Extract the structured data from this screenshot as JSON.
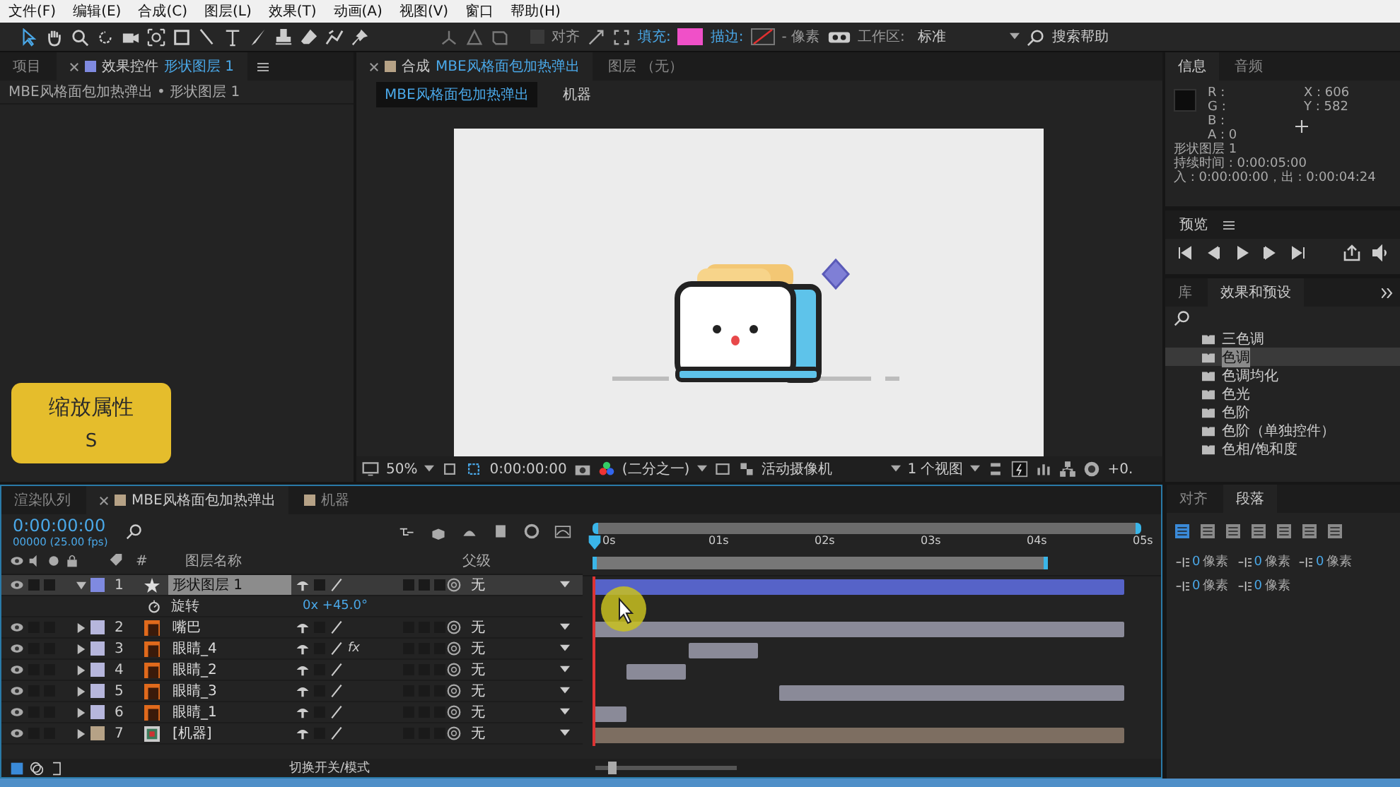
{
  "menu": [
    "文件(F)",
    "编辑(E)",
    "合成(C)",
    "图层(L)",
    "效果(T)",
    "动画(A)",
    "视图(V)",
    "窗口",
    "帮助(H)"
  ],
  "toolbar": {
    "snap": {
      "label": "对齐",
      "checked": false
    },
    "fill": {
      "label": "填充:",
      "color": "#f050c8"
    },
    "stroke": {
      "label": "描边:"
    },
    "stroke_width": "- 像素",
    "workspace_label": "工作区:",
    "workspace": "标准",
    "search_help": "搜索帮助"
  },
  "left_panel": {
    "tabs": [
      {
        "label": "项目",
        "selected": false
      },
      {
        "label": "效果控件",
        "target": "形状图层 1",
        "selected": true
      }
    ],
    "breadcrumb": "MBE风格面包加热弹出 • 形状图层 1"
  },
  "callout": {
    "title": "缩放属性",
    "key": "S"
  },
  "comp_panel": {
    "tabs": [
      {
        "label": "合成",
        "target": "MBE风格面包加热弹出",
        "selected": true
      },
      {
        "label": "图层 （无）",
        "selected": false
      }
    ],
    "breadcrumb": [
      {
        "label": "MBE风格面包加热弹出",
        "selected": true
      },
      {
        "label": "机器",
        "selected": false
      }
    ],
    "footer": {
      "zoom": "50%",
      "time": "0:00:00:00",
      "resolution": "(二分之一)",
      "camera": "活动摄像机",
      "views": "1 个视图",
      "exposure": "+0."
    }
  },
  "info": {
    "tabs": [
      {
        "label": "信息",
        "selected": true
      },
      {
        "label": "音频",
        "selected": false
      }
    ],
    "channels": [
      "R :",
      "G :",
      "B :",
      "A : 0"
    ],
    "coords": [
      "X : 606",
      "Y : 582"
    ],
    "layer": "形状图层 1",
    "duration": "持续时间 : 0:00:05:00",
    "in_out": "入 : 0:00:00:00，出 : 0:00:04:24"
  },
  "preview": {
    "title": "预览"
  },
  "effects": {
    "tabs": [
      {
        "label": "库",
        "selected": false
      },
      {
        "label": "效果和预设",
        "selected": true
      }
    ],
    "items": [
      {
        "label": "三色调",
        "selected": false
      },
      {
        "label": "色调",
        "selected": true
      },
      {
        "label": "色调均化",
        "selected": false
      },
      {
        "label": "色光",
        "selected": false
      },
      {
        "label": "色阶",
        "selected": false
      },
      {
        "label": "色阶（单独控件）",
        "selected": false
      },
      {
        "label": "色相/饱和度",
        "selected": false
      }
    ]
  },
  "timeline": {
    "tabs": [
      {
        "label": "渲染队列",
        "selected": false
      },
      {
        "label": "MBE风格面包加热弹出",
        "selected": true
      },
      {
        "label": "机器",
        "selected": false
      }
    ],
    "time": "0:00:00:00",
    "fps": "00000 (25.00 fps)",
    "columns": {
      "number": "#",
      "name": "图层名称",
      "parent": "父级"
    },
    "layers": [
      {
        "number": "1",
        "name": "形状图层 1",
        "kind": "shape",
        "color": "#7f8ae0",
        "selected": true,
        "expanded": true,
        "parent": "无",
        "properties": [
          {
            "name": "旋转",
            "value": "0x +45.0°"
          }
        ]
      },
      {
        "number": "2",
        "name": "嘴巴",
        "kind": "ai",
        "color": "#b6b6dc",
        "selected": false,
        "expanded": false,
        "parent": "无"
      },
      {
        "number": "3",
        "name": "眼睛_4",
        "kind": "ai",
        "color": "#b6b6dc",
        "selected": false,
        "expanded": false,
        "badge": "fx",
        "parent": "无"
      },
      {
        "number": "4",
        "name": "眼睛_2",
        "kind": "ai",
        "color": "#b6b6dc",
        "selected": false,
        "expanded": false,
        "parent": "无"
      },
      {
        "number": "5",
        "name": "眼睛_3",
        "kind": "ai",
        "color": "#b6b6dc",
        "selected": false,
        "expanded": false,
        "parent": "无"
      },
      {
        "number": "6",
        "name": "眼睛_1",
        "kind": "ai",
        "color": "#b6b6dc",
        "selected": false,
        "expanded": false,
        "parent": "无"
      },
      {
        "number": "7",
        "name": "[机器]",
        "kind": "composition",
        "color": "#b6a286",
        "selected": false,
        "expanded": false,
        "parent": "无"
      }
    ],
    "footer": "切换开关/模式",
    "zoom_slider": {
      "level": 0.1
    },
    "ruler": [
      "0s",
      "01s",
      "02s",
      "03s",
      "04s",
      "05s"
    ]
  },
  "paragraph": {
    "tabs": [
      {
        "label": "对齐",
        "selected": false
      },
      {
        "label": "段落",
        "selected": true
      }
    ],
    "indents": [
      {
        "value": "0",
        "unit": "像素"
      },
      {
        "value": "0",
        "unit": "像素"
      },
      {
        "value": "0",
        "unit": "像素"
      },
      {
        "value": "0",
        "unit": "像素"
      },
      {
        "value": "0",
        "unit": "像素"
      }
    ]
  }
}
